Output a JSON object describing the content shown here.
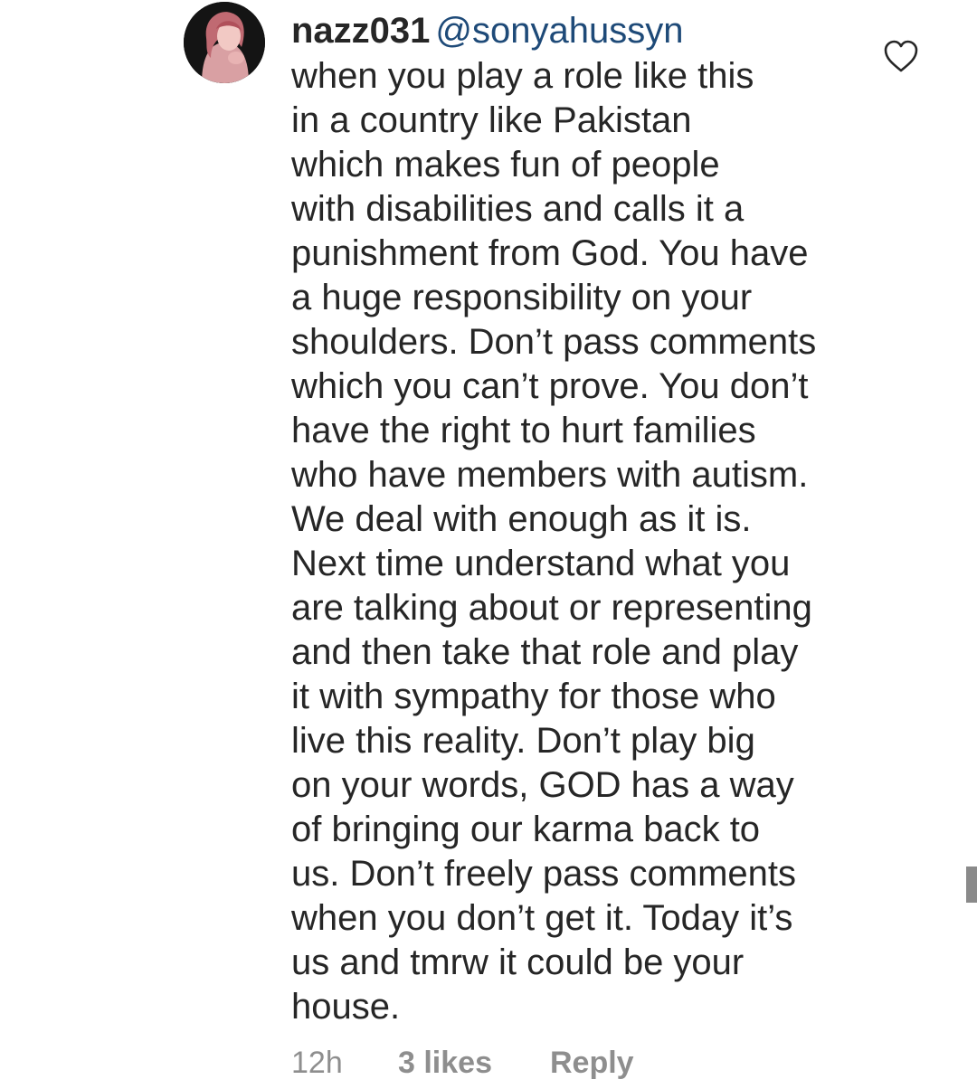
{
  "comment": {
    "username": "nazz031",
    "mention": "@sonyahussyn",
    "lines": [
      "when you play a role like this",
      "in a country like Pakistan",
      "which makes fun of people",
      "with disabilities and calls it a",
      "punishment from God. You have",
      "a huge responsibility on your",
      "shoulders. Don’t pass comments",
      "which you can’t prove. You don’t",
      "have the right to hurt families",
      "who have members with autism.",
      "We deal with enough as it is.",
      "Next time understand what you",
      "are talking about or representing",
      "and then take that role and play",
      "it with sympathy for those who",
      "live this reality. Don’t play big",
      "on your words, GOD has a way",
      "of bringing our karma back to",
      "us. Don’t freely pass comments",
      "when you don’t get it. Today it’s",
      "us and tmrw it could be your",
      "house."
    ],
    "time_ago": "12h",
    "likes": "3 likes",
    "reply_label": "Reply"
  },
  "icons": {
    "like": "heart-outline-icon",
    "avatar": "profile-avatar"
  },
  "colors": {
    "text": "#262626",
    "mention": "#1e4a78",
    "meta": "#8e8e8e",
    "background": "#ffffff"
  }
}
